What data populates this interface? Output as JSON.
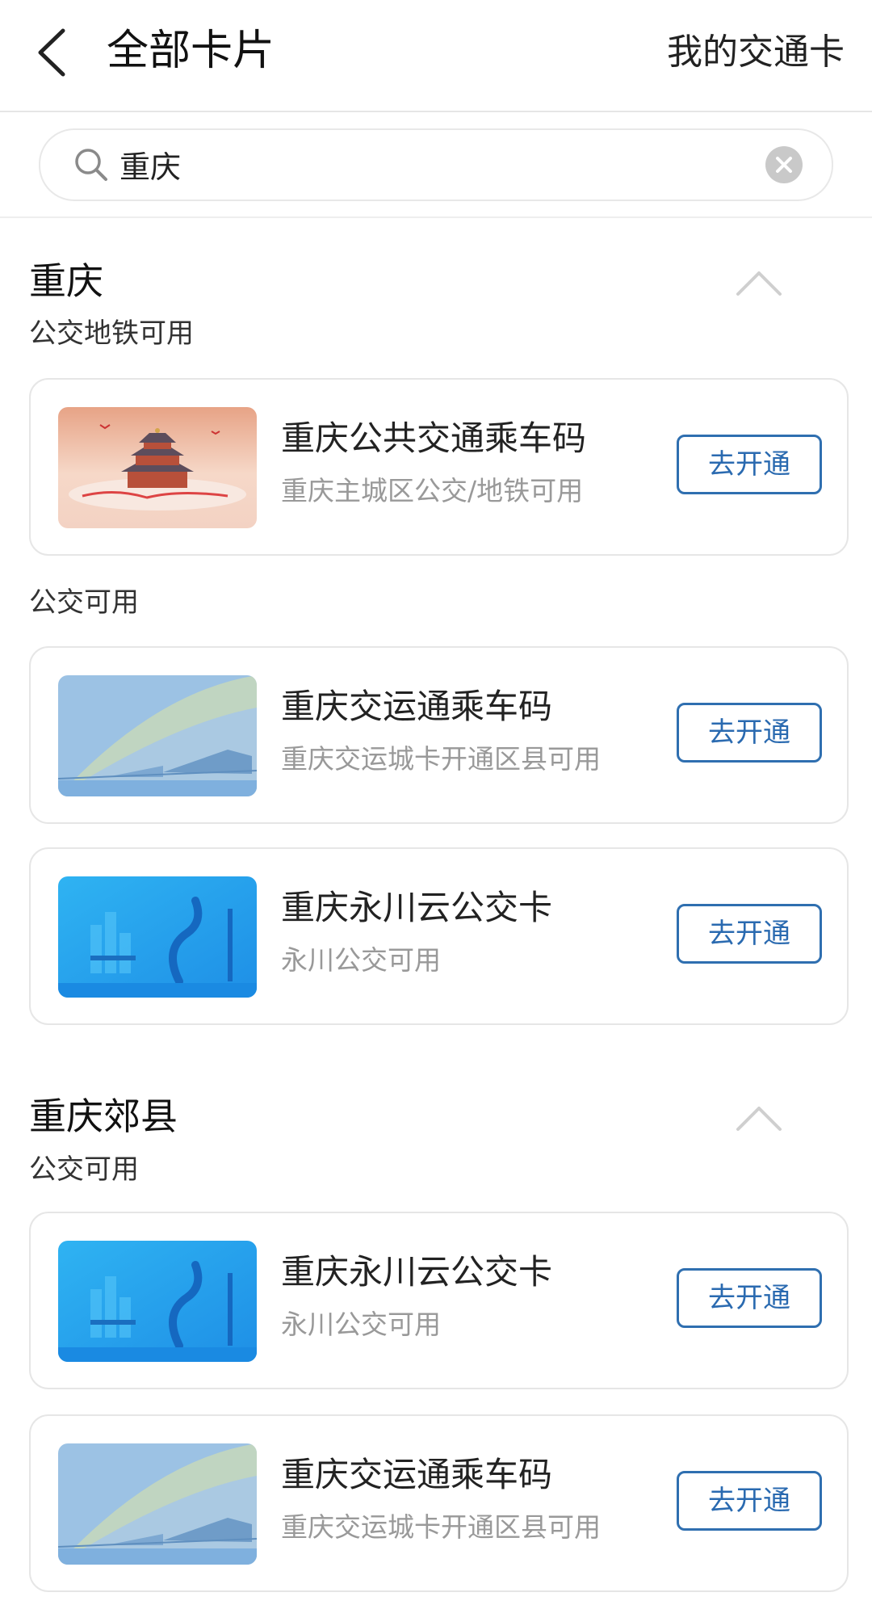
{
  "header": {
    "title": "全部卡片",
    "my_cards_link": "我的交通卡"
  },
  "search": {
    "value": "重庆",
    "placeholder": ""
  },
  "sections": [
    {
      "title": "重庆",
      "groups": [
        {
          "subtitle": "公交地铁可用",
          "cards": [
            {
              "name": "重庆公共交通乘车码",
              "desc": "重庆主城区公交/地铁可用",
              "button": "去开通",
              "thumb": "temple-card"
            }
          ]
        },
        {
          "subtitle": "公交可用",
          "cards": [
            {
              "name": "重庆交运通乘车码",
              "desc": "重庆交运城卡开通区县可用",
              "button": "去开通",
              "thumb": "train-card"
            },
            {
              "name": "重庆永川云公交卡",
              "desc": "永川公交可用",
              "button": "去开通",
              "thumb": "yongchuan-card"
            }
          ]
        }
      ]
    },
    {
      "title": "重庆郊县",
      "groups": [
        {
          "subtitle": "公交可用",
          "cards": [
            {
              "name": "重庆永川云公交卡",
              "desc": "永川公交可用",
              "button": "去开通",
              "thumb": "yongchuan-card"
            },
            {
              "name": "重庆交运通乘车码",
              "desc": "重庆交运城卡开通区县可用",
              "button": "去开通",
              "thumb": "train-card"
            }
          ]
        }
      ]
    }
  ],
  "colors": {
    "accent": "#2f6fb0",
    "divider": "#e6e6e6",
    "muted_text": "#999999"
  }
}
